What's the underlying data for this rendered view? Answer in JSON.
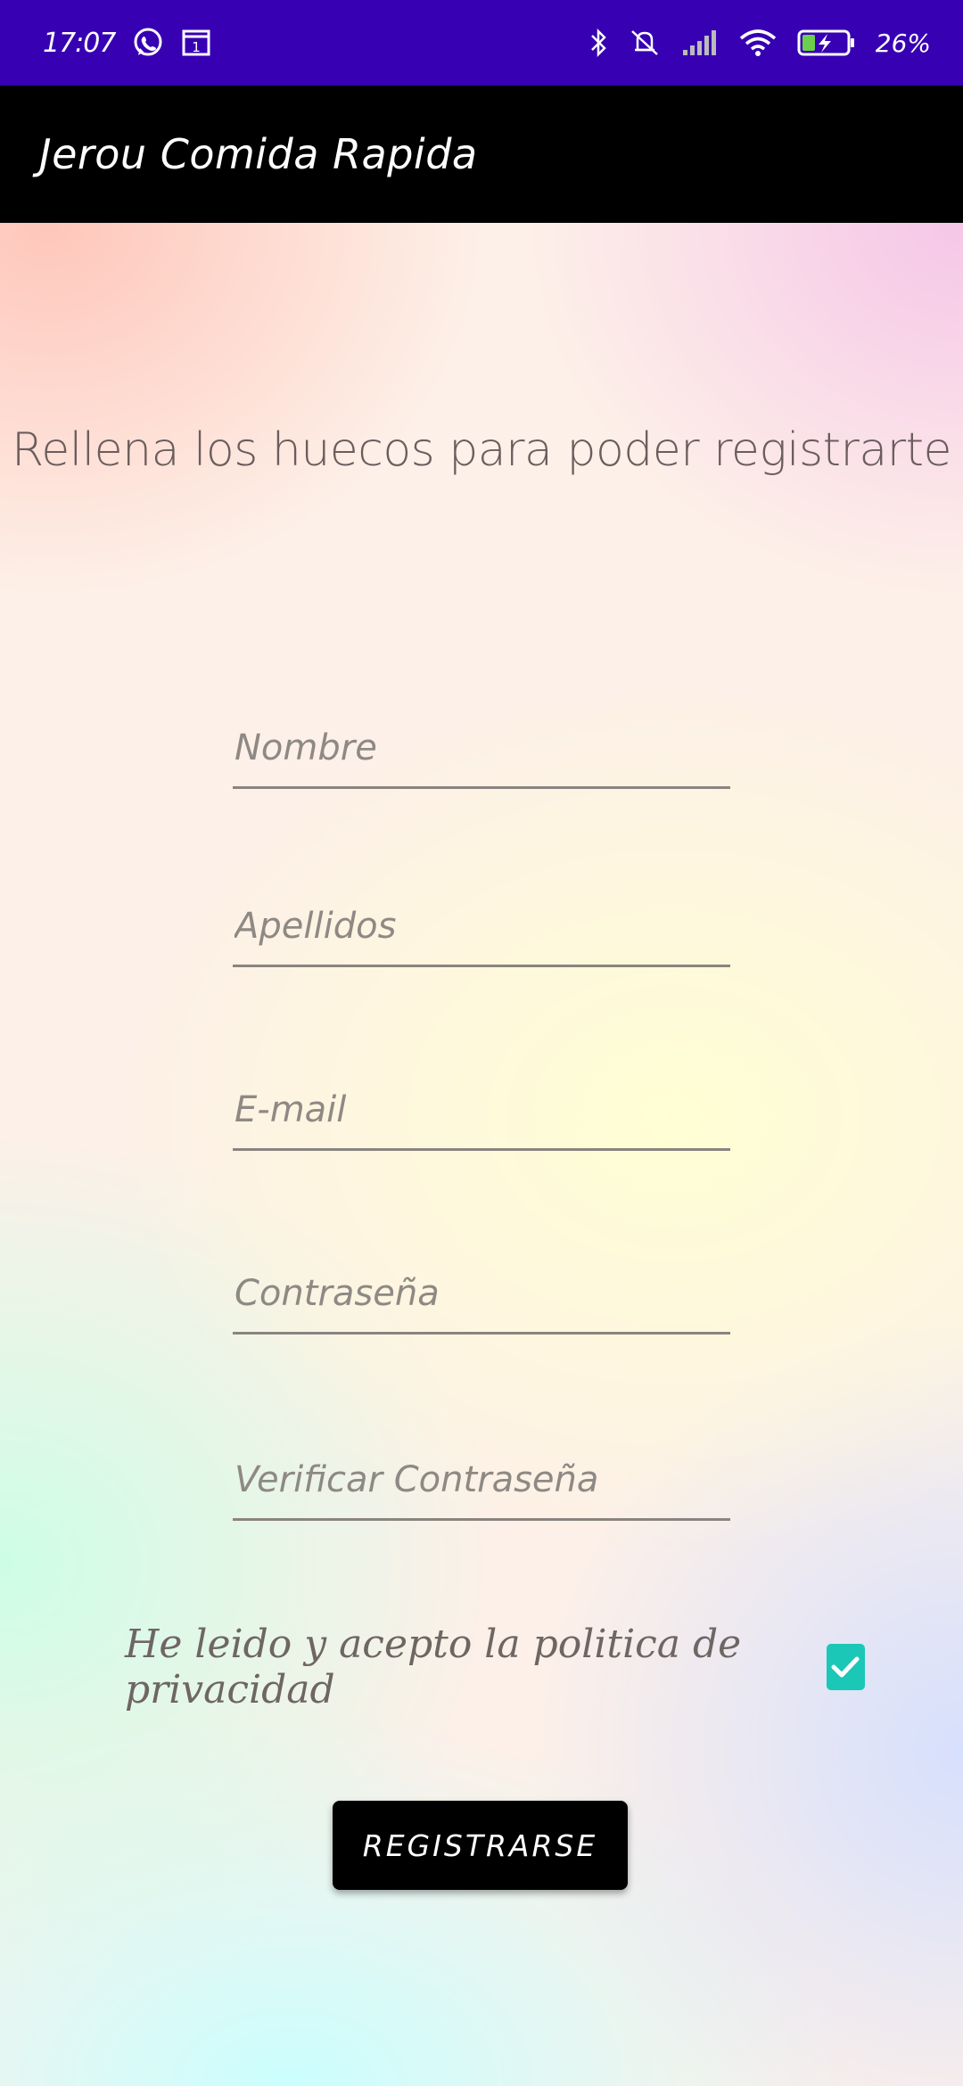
{
  "status_bar": {
    "time": "17:07",
    "battery": "26%",
    "icons": [
      "whatsapp-icon",
      "calendar-icon",
      "bluetooth-icon",
      "silent-icon",
      "signal-icon",
      "wifi-icon",
      "battery-charging-icon"
    ],
    "calendar_day": "1",
    "background": "#3700b3"
  },
  "toolbar": {
    "title": "Jerou Comida Rapida",
    "background": "#000000"
  },
  "form": {
    "heading": "Rellena los huecos para poder registrarte",
    "fields": [
      {
        "placeholder": "Nombre",
        "value": ""
      },
      {
        "placeholder": "Apellidos",
        "value": ""
      },
      {
        "placeholder": "E-mail",
        "value": ""
      },
      {
        "placeholder": "Contraseña",
        "value": ""
      },
      {
        "placeholder": "Verificar Contraseña",
        "value": ""
      }
    ],
    "privacy_label": "He leido y acepto la politica de privacidad",
    "privacy_checked": true,
    "checkbox_color": "#1bc7b6",
    "submit_label": "REGISTRARSE"
  }
}
